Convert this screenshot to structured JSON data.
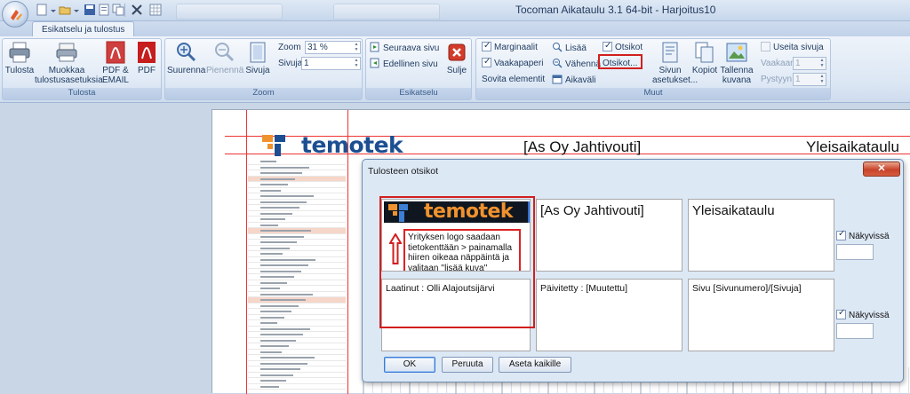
{
  "window": {
    "title": "Tocoman Aikataulu 3.1 64-bit - Harjoitus10"
  },
  "tabs": [
    {
      "label": "Esikatselu ja tulostus",
      "selected": true
    }
  ],
  "ribbon": {
    "tulosta": {
      "caption": "Tulosta",
      "print_label": "Tulosta",
      "edit_settings_label": "Muokkaa tulostusasetuksia",
      "pdf_email_label": "PDF & EMAIL",
      "pdf_label": "PDF"
    },
    "zoom": {
      "caption": "Zoom",
      "zoom_in_label": "Suurenna",
      "zoom_out_label": "Pienennä",
      "page_label": "Sivuja",
      "zoom_field_label": "Zoom",
      "zoom_value": "31 %",
      "pages_field_label": "Sivuja",
      "pages_value": "1"
    },
    "esikatselu": {
      "caption": "Esikatselu",
      "next_page_label": "Seuraava sivu",
      "prev_page_label": "Edellinen sivu",
      "close_label": "Sulje"
    },
    "muut": {
      "caption": "Muut",
      "margins_label": "Marginaalit",
      "margins_checked": true,
      "landscape_label": "Vaakapaperi",
      "landscape_checked": true,
      "fit_label": "Sovita elementit",
      "add_label": "Lisää",
      "reduce_label": "Vähennä",
      "timespan_label": "Aikaväli",
      "titles_label": "Otsikot",
      "titles_checked": true,
      "titles_button_label": "Otsikot...",
      "page_settings_label": "Sivun asetukset...",
      "copies_label": "Kopiot",
      "save_image_label": "Tallenna kuvana",
      "multi_page_label": "Useita sivuja",
      "multi_page_checked": false,
      "horizontal_label": "Vaakaan",
      "horizontal_value": "1",
      "vertical_label": "Pystyyn",
      "vertical_value": "1"
    }
  },
  "preview": {
    "logo_text": "temotek",
    "header_center": "[As Oy Jahtivouti]",
    "header_right": "Yleisaikataulu"
  },
  "dialog": {
    "title": "Tulosteen otsikot",
    "close_symbol": "✕",
    "header_cells": {
      "logo_text": "temotek",
      "center": "[As Oy Jahtivouti]",
      "right": "Yleisaikataulu"
    },
    "footer_cells": {
      "left": "Laatinut : Olli Alajoutsijärvi",
      "center": "Päivitetty : [Muutettu]",
      "right": "Sivu [Sivunumero]/[Sivuja]"
    },
    "annotation": "Yrityksen logo saadaan tietokenttään > painamalla hiiren oikeaa näppäintä ja valitaan ''lisää kuva''",
    "header_visible_label": "Näkyvissä",
    "header_visible_checked": true,
    "footer_visible_label": "Näkyvissä",
    "footer_visible_checked": true,
    "buttons": {
      "ok": "OK",
      "cancel": "Peruuta",
      "apply_all": "Aseta kaikille"
    }
  },
  "colors": {
    "logo_blue": "#1b4f92",
    "logo_orange": "#f0922e",
    "highlight_red": "#d21f1f"
  }
}
